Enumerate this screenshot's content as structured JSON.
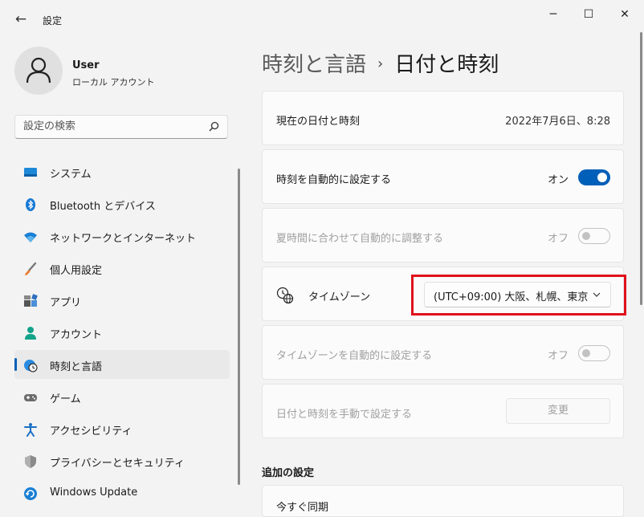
{
  "window": {
    "title": "設定"
  },
  "user": {
    "name": "User",
    "account_type": "ローカル アカウント"
  },
  "search": {
    "placeholder": "設定の検索"
  },
  "sidebar": {
    "items": [
      {
        "label": "システム",
        "icon": "display-icon"
      },
      {
        "label": "Bluetooth とデバイス",
        "icon": "bluetooth-icon"
      },
      {
        "label": "ネットワークとインターネット",
        "icon": "wifi-icon"
      },
      {
        "label": "個人用設定",
        "icon": "brush-icon"
      },
      {
        "label": "アプリ",
        "icon": "apps-icon"
      },
      {
        "label": "アカウント",
        "icon": "person-icon"
      },
      {
        "label": "時刻と言語",
        "icon": "time-language-icon",
        "active": true
      },
      {
        "label": "ゲーム",
        "icon": "gamepad-icon"
      },
      {
        "label": "アクセシビリティ",
        "icon": "accessibility-icon"
      },
      {
        "label": "プライバシーとセキュリティ",
        "icon": "shield-icon"
      },
      {
        "label": "Windows Update",
        "icon": "update-icon"
      }
    ]
  },
  "breadcrumb": {
    "parent": "時刻と言語",
    "separator": "›",
    "current": "日付と時刻"
  },
  "settings": {
    "current_datetime": {
      "label": "現在の日付と時刻",
      "value": "2022年7月6日、8:28"
    },
    "auto_time": {
      "label": "時刻を自動的に設定する",
      "state_label": "オン",
      "on": true
    },
    "dst": {
      "label": "夏時間に合わせて自動的に調整する",
      "state_label": "オフ",
      "on": false
    },
    "timezone": {
      "label": "タイムゾーン",
      "value": "(UTC+09:00) 大阪、札幌、東京"
    },
    "auto_timezone": {
      "label": "タイムゾーンを自動的に設定する",
      "state_label": "オフ",
      "on": false
    },
    "manual": {
      "label": "日付と時刻を手動で設定する",
      "button_label": "変更"
    }
  },
  "additional": {
    "title": "追加の設定",
    "sync_now": "今すぐ同期"
  },
  "colors": {
    "accent": "#005fb8",
    "highlight": "#e0111c",
    "background": "#f3f3f3",
    "card": "#fbfbfb"
  }
}
